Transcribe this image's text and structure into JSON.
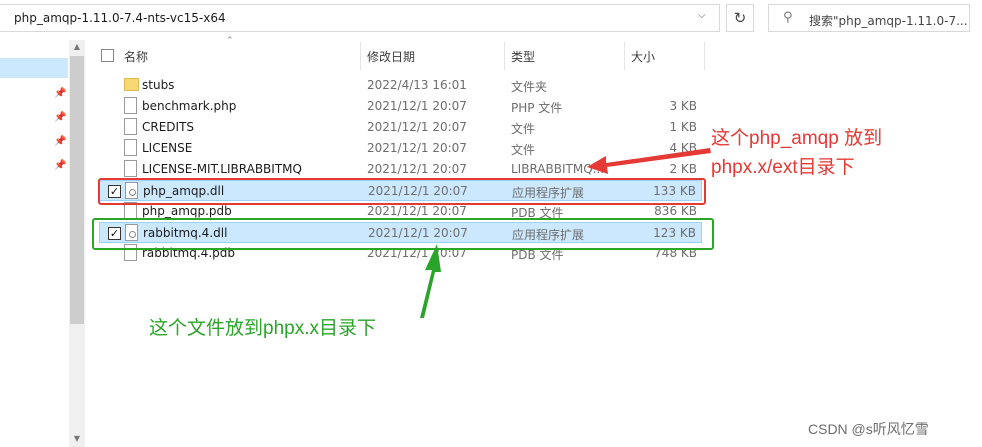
{
  "address": {
    "path": "php_amqp-1.11.0-7.4-nts-vc15-x64"
  },
  "search": {
    "text": "搜索\"php_amqp-1.11.0-7..."
  },
  "columns": {
    "name": "名称",
    "date": "修改日期",
    "type": "类型",
    "size": "大小"
  },
  "files": [
    {
      "name": "stubs",
      "date": "2022/4/13 16:01",
      "type": "文件夹",
      "size": "",
      "icon": "folder-icon",
      "selected": false
    },
    {
      "name": "benchmark.php",
      "date": "2021/12/1 20:07",
      "type": "PHP 文件",
      "size": "3 KB",
      "icon": "file-icon",
      "selected": false
    },
    {
      "name": "CREDITS",
      "date": "2021/12/1 20:07",
      "type": "文件",
      "size": "1 KB",
      "icon": "file-icon",
      "selected": false
    },
    {
      "name": "LICENSE",
      "date": "2021/12/1 20:07",
      "type": "文件",
      "size": "4 KB",
      "icon": "file-icon",
      "selected": false
    },
    {
      "name": "LICENSE-MIT.LIBRABBITMQ",
      "date": "2021/12/1 20:07",
      "type": "LIBRABBITMQ...",
      "size": "2 KB",
      "icon": "file-icon",
      "selected": false
    },
    {
      "name": "php_amqp.dll",
      "date": "2021/12/1 20:07",
      "type": "应用程序扩展",
      "size": "133 KB",
      "icon": "dll-icon",
      "selected": true
    },
    {
      "name": "php_amqp.pdb",
      "date": "2021/12/1 20:07",
      "type": "PDB 文件",
      "size": "836 KB",
      "icon": "file-icon",
      "selected": false
    },
    {
      "name": "rabbitmq.4.dll",
      "date": "2021/12/1 20:07",
      "type": "应用程序扩展",
      "size": "123 KB",
      "icon": "dll-icon",
      "selected": true
    },
    {
      "name": "rabbitmq.4.pdb",
      "date": "2021/12/1 20:07",
      "type": "PDB 文件",
      "size": "748 KB",
      "icon": "file-icon",
      "selected": false
    }
  ],
  "annotations": {
    "red_line1": "这个php_amqp 放到",
    "red_line2": "phpx.x/ext目录下",
    "green": "这个文件放到phpx.x目录下",
    "red_color": "#e53935",
    "green_color": "#2aa52a"
  },
  "watermark": "CSDN @s听风忆雪"
}
